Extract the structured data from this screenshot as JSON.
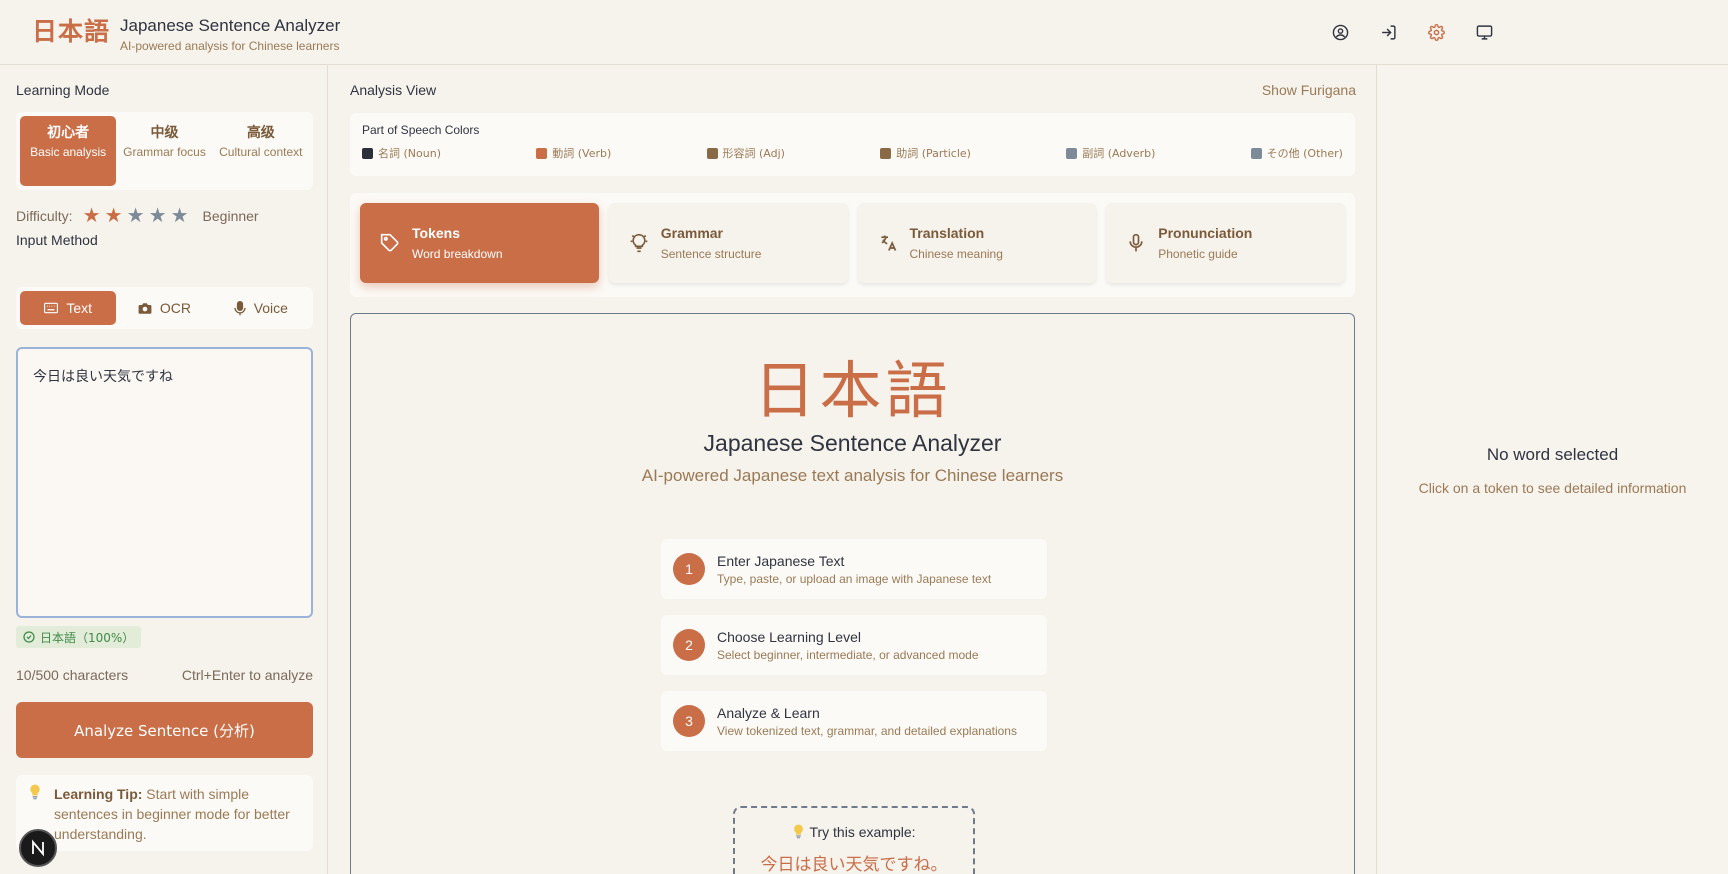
{
  "header": {
    "logo": "日本語",
    "title": "Japanese Sentence Analyzer",
    "subtitle": "AI-powered analysis for Chinese learners",
    "icons": [
      "user-circle-icon",
      "login-icon",
      "settings-icon",
      "monitor-icon"
    ]
  },
  "left": {
    "learning_mode_label": "Learning Mode",
    "modes": [
      {
        "kanji": "初心者",
        "desc": "Basic analysis",
        "active": true
      },
      {
        "kanji": "中级",
        "desc": "Grammar focus",
        "active": false
      },
      {
        "kanji": "高级",
        "desc": "Cultural context",
        "active": false
      }
    ],
    "difficulty_label": "Difficulty:",
    "difficulty_stars": 2,
    "difficulty_max": 5,
    "difficulty_level": "Beginner",
    "input_method_label": "Input Method",
    "input_methods": [
      {
        "label": "Text",
        "icon": "keyboard-icon",
        "active": true
      },
      {
        "label": "OCR",
        "icon": "camera-icon",
        "active": false
      },
      {
        "label": "Voice",
        "icon": "microphone-icon",
        "active": false
      }
    ],
    "input_value": "今日は良い天気ですね",
    "language_badge": "日本語（100%）",
    "char_count": "10/500 characters",
    "shortcut_hint": "Ctrl+Enter to analyze",
    "analyze_button": "Analyze Sentence (分析)",
    "tip_label": "Learning Tip:",
    "tip_text": " Start with simple sentences in beginner mode for better understanding."
  },
  "center": {
    "analysis_view_label": "Analysis View",
    "show_furigana": "Show Furigana",
    "pos_title": "Part of Speech Colors",
    "pos_items": [
      {
        "label": "名詞 (Noun)",
        "color": "#2b2f3a"
      },
      {
        "label": "動詞 (Verb)",
        "color": "#c96e47"
      },
      {
        "label": "形容詞 (Adj)",
        "color": "#8a6a45"
      },
      {
        "label": "助詞 (Particle)",
        "color": "#8a6a45"
      },
      {
        "label": "副詞 (Adverb)",
        "color": "#7d8b99"
      },
      {
        "label": "その他 (Other)",
        "color": "#7d8b99"
      }
    ],
    "tabs": [
      {
        "title": "Tokens",
        "sub": "Word breakdown",
        "icon": "tag-icon",
        "active": true
      },
      {
        "title": "Grammar",
        "sub": "Sentence structure",
        "icon": "lightbulb-icon",
        "active": false
      },
      {
        "title": "Translation",
        "sub": "Chinese meaning",
        "icon": "translate-icon",
        "active": false
      },
      {
        "title": "Pronunciation",
        "sub": "Phonetic guide",
        "icon": "microphone-icon",
        "active": false
      }
    ],
    "hero_logo": "日本語",
    "hero_title": "Japanese Sentence Analyzer",
    "hero_subtitle": "AI-powered Japanese text analysis for Chinese learners",
    "steps": [
      {
        "num": "1",
        "title": "Enter Japanese Text",
        "sub": "Type, paste, or upload an image with Japanese text"
      },
      {
        "num": "2",
        "title": "Choose Learning Level",
        "sub": "Select beginner, intermediate, or advanced mode"
      },
      {
        "num": "3",
        "title": "Analyze & Learn",
        "sub": "View tokenized text, grammar, and detailed explanations"
      }
    ],
    "example_label": "Try this example:",
    "example_text": "今日は良い天気ですね。"
  },
  "right": {
    "empty_title": "No word selected",
    "empty_sub": "Click on a token to see detailed information"
  },
  "colors": {
    "accent": "#c96e47",
    "background": "#f6f2ec",
    "panel": "#fcfaf6"
  }
}
